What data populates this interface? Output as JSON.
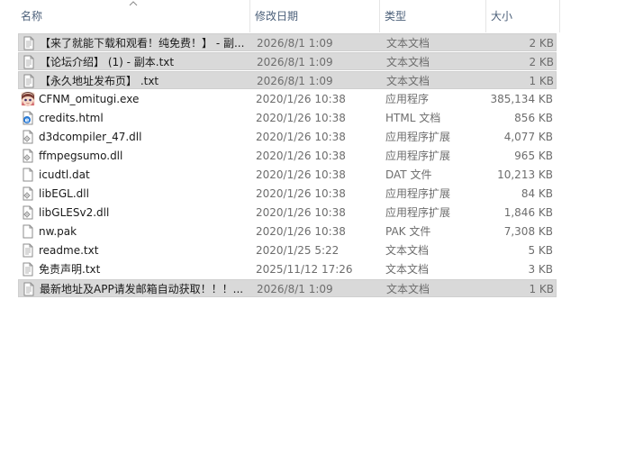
{
  "columns": {
    "name": "名称",
    "date": "修改日期",
    "type": "类型",
    "size": "大小"
  },
  "files": [
    {
      "name": "【来了就能下载和观看！纯免费！】 - 副...",
      "date": "2026/8/1 1:09",
      "type": "文本文档",
      "size": "2 KB",
      "icon": "text-file-icon",
      "selected": true
    },
    {
      "name": "【论坛介绍】 (1) - 副本.txt",
      "date": "2026/8/1 1:09",
      "type": "文本文档",
      "size": "2 KB",
      "icon": "text-file-icon",
      "selected": true
    },
    {
      "name": "【永久地址发布页】 .txt",
      "date": "2026/8/1 1:09",
      "type": "文本文档",
      "size": "1 KB",
      "icon": "text-file-icon",
      "selected": true
    },
    {
      "name": "CFNM_omitugi.exe",
      "date": "2020/1/26 10:38",
      "type": "应用程序",
      "size": "385,134 KB",
      "icon": "app-character-icon",
      "selected": false
    },
    {
      "name": "credits.html",
      "date": "2020/1/26 10:38",
      "type": "HTML 文档",
      "size": "856 KB",
      "icon": "html-file-icon",
      "selected": false
    },
    {
      "name": "d3dcompiler_47.dll",
      "date": "2020/1/26 10:38",
      "type": "应用程序扩展",
      "size": "4,077 KB",
      "icon": "dll-file-icon",
      "selected": false
    },
    {
      "name": "ffmpegsumo.dll",
      "date": "2020/1/26 10:38",
      "type": "应用程序扩展",
      "size": "965 KB",
      "icon": "dll-file-icon",
      "selected": false
    },
    {
      "name": "icudtl.dat",
      "date": "2020/1/26 10:38",
      "type": "DAT 文件",
      "size": "10,213 KB",
      "icon": "blank-file-icon",
      "selected": false
    },
    {
      "name": "libEGL.dll",
      "date": "2020/1/26 10:38",
      "type": "应用程序扩展",
      "size": "84 KB",
      "icon": "dll-file-icon",
      "selected": false
    },
    {
      "name": "libGLESv2.dll",
      "date": "2020/1/26 10:38",
      "type": "应用程序扩展",
      "size": "1,846 KB",
      "icon": "dll-file-icon",
      "selected": false
    },
    {
      "name": "nw.pak",
      "date": "2020/1/26 10:38",
      "type": "PAK 文件",
      "size": "7,308 KB",
      "icon": "blank-file-icon",
      "selected": false
    },
    {
      "name": "readme.txt",
      "date": "2020/1/25 5:22",
      "type": "文本文档",
      "size": "5 KB",
      "icon": "text-file-icon",
      "selected": false
    },
    {
      "name": "免责声明.txt",
      "date": "2025/11/12 17:26",
      "type": "文本文档",
      "size": "3 KB",
      "icon": "text-file-icon",
      "selected": false
    },
    {
      "name": "最新地址及APP请发邮箱自动获取！！！...",
      "date": "2026/8/1 1:09",
      "type": "文本文档",
      "size": "1 KB",
      "icon": "text-file-icon",
      "selected": true
    }
  ],
  "colors": {
    "selected_row": "#d9d9d9",
    "header_text": "#4c607a",
    "secondary_text": "#6d6d6d"
  }
}
